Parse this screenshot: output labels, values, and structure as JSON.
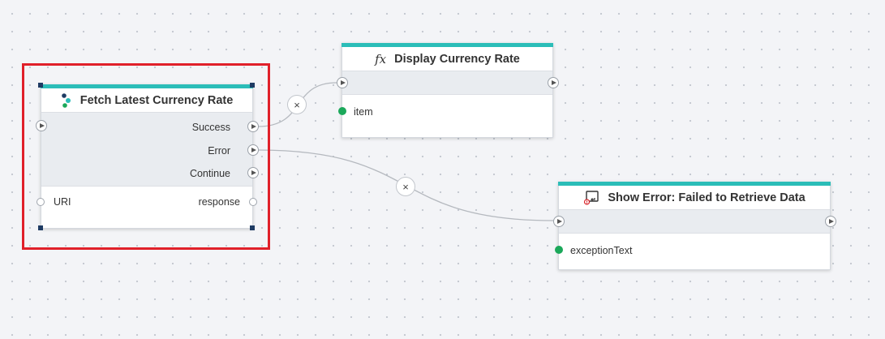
{
  "nodes": {
    "fetch": {
      "title": "Fetch Latest Currency Rate",
      "outputs": [
        "Success",
        "Error",
        "Continue"
      ],
      "input_label": "URI",
      "output_label": "response"
    },
    "display": {
      "title": "Display Currency Rate",
      "icon_text": "fx",
      "input_label": "item"
    },
    "show_error": {
      "title": "Show Error: Failed to Retrieve Data",
      "input_label": "exceptionText"
    }
  },
  "connectors": {
    "remove_symbol": "×"
  },
  "colors": {
    "accent": "#2bbdb8",
    "selection": "#e0202a",
    "data_port": "#1ba85a",
    "handle": "#1e3b63"
  },
  "icons": {
    "fetch": "http-request-icon",
    "display": "function-icon",
    "show_error": "error-dialog-icon"
  }
}
